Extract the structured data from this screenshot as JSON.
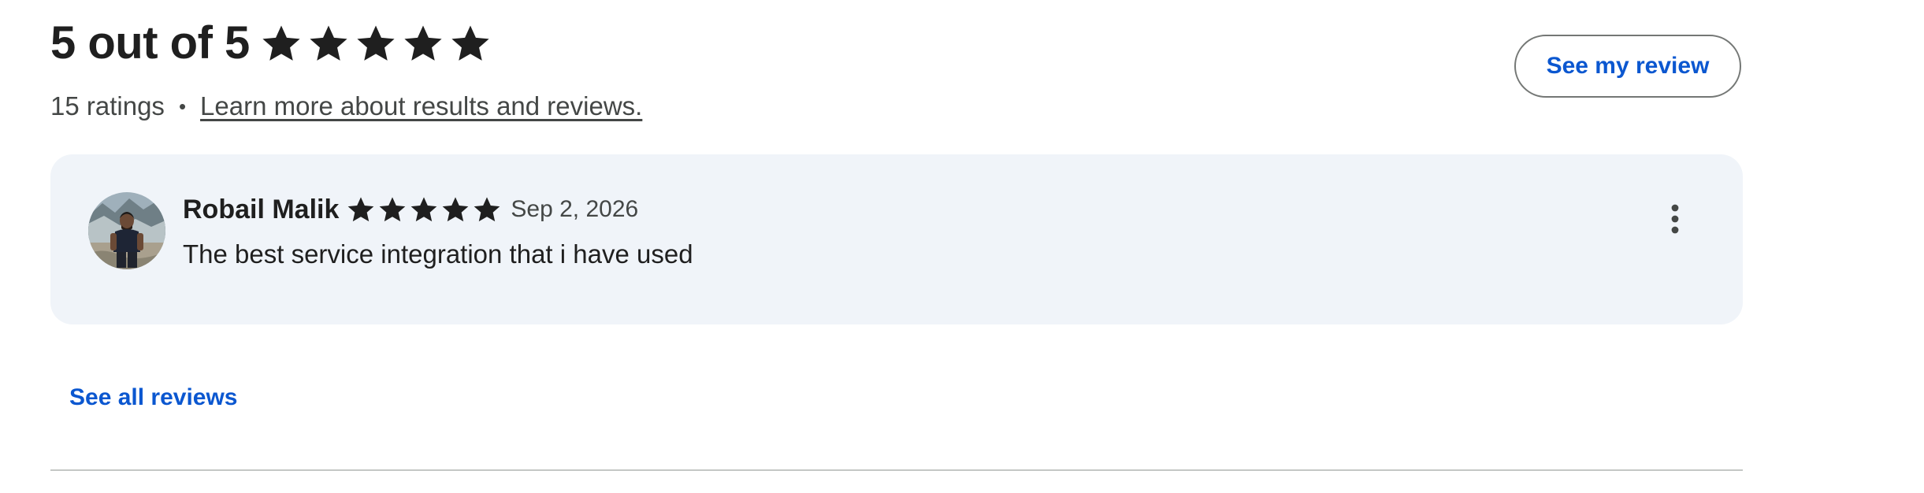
{
  "summary": {
    "title": "5 out of 5",
    "rating": 5,
    "max_rating": 5,
    "ratings_count_text": "15 ratings",
    "separator": "•",
    "learn_more_link": "Learn more about results and reviews.",
    "star_color": "#1f1f1f"
  },
  "actions": {
    "see_my_review_label": "See my review",
    "see_all_reviews_label": "See all reviews",
    "accent_color": "#0b57d0"
  },
  "review": {
    "reviewer_name": "Robail Malik",
    "rating": 5,
    "date": "Sep 2, 2026",
    "text": "The best service integration that i have used",
    "card_color": "#f0f4f9",
    "menu_icon": "more-vertical-icon"
  }
}
